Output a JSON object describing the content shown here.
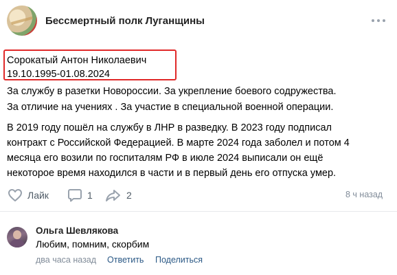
{
  "group": {
    "name": "Бессмертный полк Луганщины",
    "avatar_caption": "Бессмертный полк Луганщины"
  },
  "post": {
    "lines": [
      "Сорокатый Антон Николаевич",
      "19.10.1995-01.08.2024",
      "За службу в разетки Новороссии. За укрепление боевого содружества.",
      "За отличие на учениях . За участие в специальной военной операции.",
      "В 2019 году пошёл на службу в ЛНР в разведку. В 2023 году подписал",
      "контракт с Российской Федерацией. В марте 2024 года заболел и потом 4",
      "месяца его возили по госпиталям РФ в июле 2024 выписали он ещё",
      "некоторое время находился в части и в первый день его отпуска умер."
    ],
    "highlight_color": "#e02828"
  },
  "actions": {
    "like_label": "Лайк",
    "comments_count": "1",
    "shares_count": "2",
    "time_ago": "8 ч назад"
  },
  "comment": {
    "author": "Ольга Шевлякова",
    "text": "Любим, помним, скорбим",
    "time": "два часа назад",
    "reply_label": "Ответить",
    "share_label": "Поделиться"
  },
  "colors": {
    "icon_gray": "#99a2ad",
    "link_blue": "#2a5885",
    "meta_gray": "#818c99"
  },
  "icons": [
    "more-icon",
    "heart-icon",
    "comment-icon",
    "share-icon"
  ]
}
